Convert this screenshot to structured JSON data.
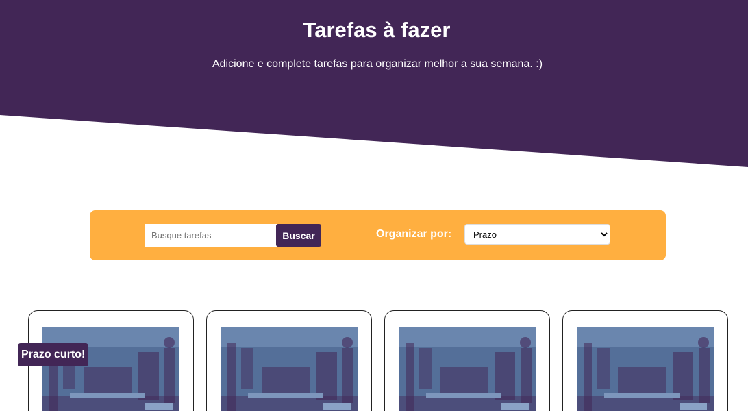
{
  "header": {
    "title": "Tarefas à fazer",
    "subtitle": "Adicione e complete tarefas para organizar melhor a sua semana. :)"
  },
  "toolbar": {
    "search_placeholder": "Busque tarefas",
    "search_button": "Buscar",
    "sort_label": "Organizar por:",
    "sort_selected": "Prazo"
  },
  "badge": {
    "label": "Prazo curto!"
  },
  "colors": {
    "primary": "#422656",
    "accent": "#FFAF40",
    "image_tint": "#546F99"
  },
  "cards": [
    {
      "image_desc": "photo"
    },
    {
      "image_desc": "photo"
    },
    {
      "image_desc": "photo"
    },
    {
      "image_desc": "photo"
    }
  ]
}
